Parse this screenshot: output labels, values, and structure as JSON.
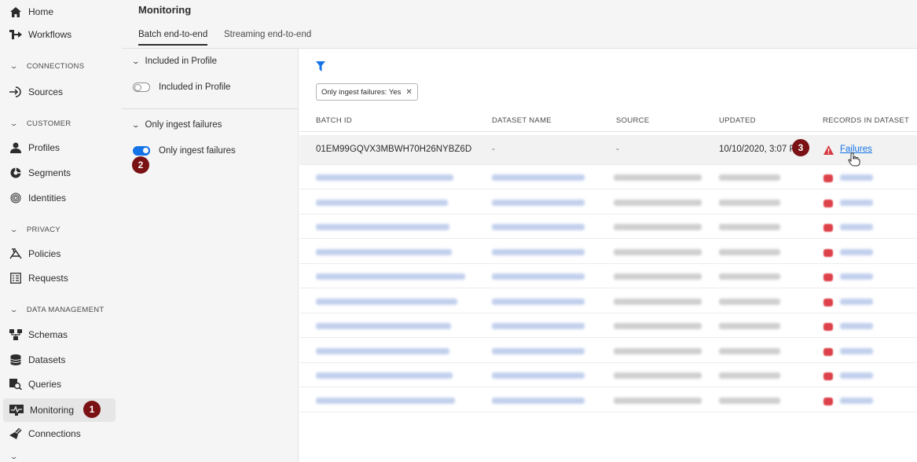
{
  "sidebar": {
    "items": [
      {
        "label": "Home",
        "icon": "home-icon"
      },
      {
        "label": "Workflows",
        "icon": "workflow-icon"
      },
      {
        "section": "CONNECTIONS"
      },
      {
        "label": "Sources",
        "icon": "sources-icon"
      },
      {
        "section": "CUSTOMER"
      },
      {
        "label": "Profiles",
        "icon": "profile-icon"
      },
      {
        "label": "Segments",
        "icon": "segments-icon"
      },
      {
        "label": "Identities",
        "icon": "identities-icon"
      },
      {
        "section": "PRIVACY"
      },
      {
        "label": "Policies",
        "icon": "policies-icon"
      },
      {
        "label": "Requests",
        "icon": "requests-icon"
      },
      {
        "section": "DATA MANAGEMENT"
      },
      {
        "label": "Schemas",
        "icon": "schemas-icon"
      },
      {
        "label": "Datasets",
        "icon": "datasets-icon"
      },
      {
        "label": "Queries",
        "icon": "queries-icon"
      },
      {
        "label": "Monitoring",
        "icon": "monitoring-icon",
        "active": true
      },
      {
        "label": "Connections",
        "icon": "connections-icon"
      }
    ]
  },
  "header": {
    "title": "Monitoring",
    "tabs": [
      {
        "label": "Batch end-to-end",
        "active": true
      },
      {
        "label": "Streaming end-to-end",
        "active": false
      }
    ]
  },
  "filters": {
    "group1": {
      "title": "Included in Profile",
      "toggle_label": "Included in Profile",
      "on": false
    },
    "group2": {
      "title": "Only ingest failures",
      "toggle_label": "Only ingest failures",
      "on": true
    }
  },
  "chip": {
    "label": "Only ingest failures: Yes"
  },
  "table": {
    "columns": [
      "BATCH ID",
      "DATASET NAME",
      "SOURCE",
      "UPDATED",
      "RECORDS IN DATASET"
    ],
    "first_row": {
      "batch_id": "01EM99GQVX3MBWH70H26NYBZ6D",
      "dataset_name": "-",
      "source": "-",
      "updated": "10/10/2020, 3:07 PM",
      "records": "Failures"
    },
    "blurred_row_count": 10
  },
  "callouts": [
    "1",
    "2",
    "3"
  ],
  "colors": {
    "accent": "#1473e6",
    "badge": "#7a1114",
    "warning": "#d7373f"
  }
}
